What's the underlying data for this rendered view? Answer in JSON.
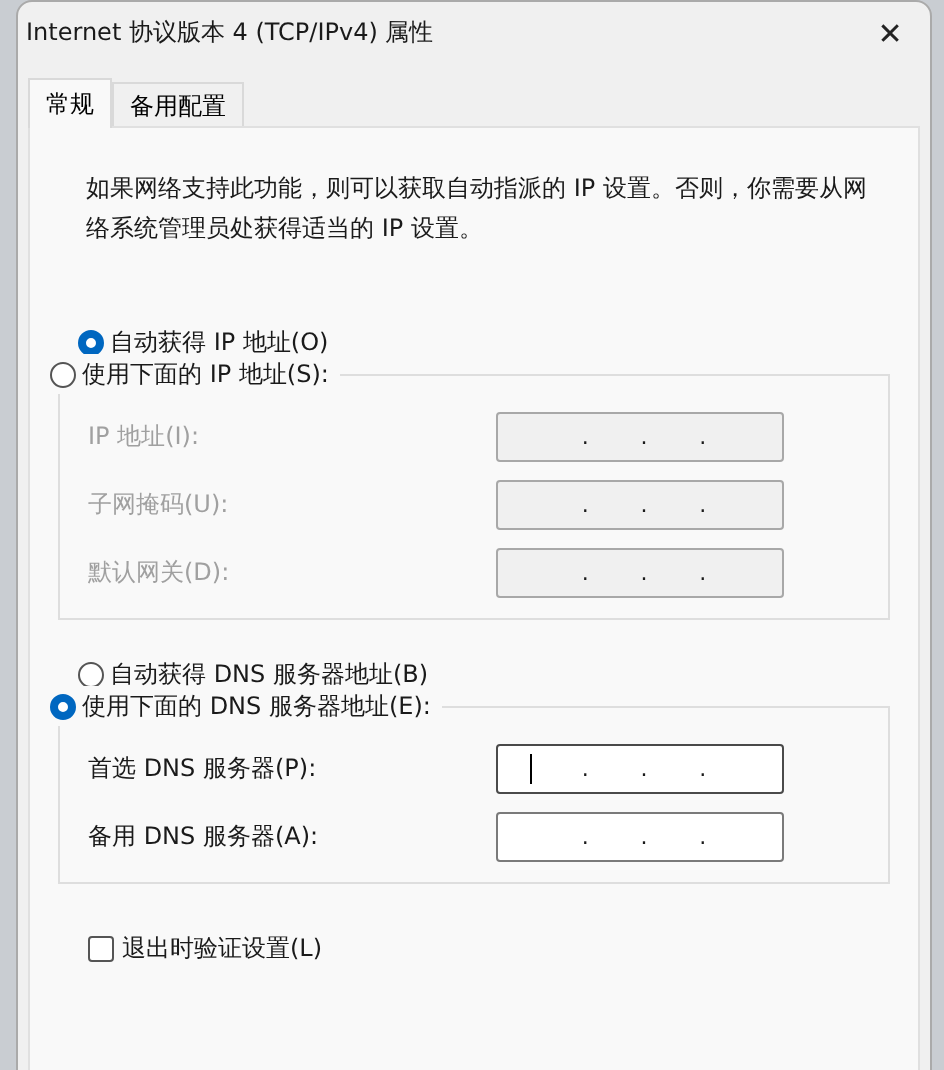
{
  "window": {
    "title": "Internet 协议版本 4 (TCP/IPv4) 属性",
    "close": "✕"
  },
  "tabs": [
    {
      "label": "常规",
      "selected": true
    },
    {
      "label": "备用配置",
      "selected": false
    }
  ],
  "description": "如果网络支持此功能，则可以获取自动指派的 IP 设置。否则，你需要从网络系统管理员处获得适当的 IP 设置。",
  "ip_mode": {
    "options": [
      {
        "label": "自动获得 IP 地址(O)",
        "selected": true
      },
      {
        "label": "使用下面的 IP 地址(S):",
        "selected": false
      }
    ],
    "fields": [
      {
        "label": "IP 地址(I):",
        "dots": [
          ".",
          ".",
          "."
        ],
        "disabled": true,
        "focused": false
      },
      {
        "label": "子网掩码(U):",
        "dots": [
          ".",
          ".",
          "."
        ],
        "disabled": true,
        "focused": false
      },
      {
        "label": "默认网关(D):",
        "dots": [
          ".",
          ".",
          "."
        ],
        "disabled": true,
        "focused": false
      }
    ]
  },
  "dns_mode": {
    "options": [
      {
        "label": "自动获得 DNS 服务器地址(B)",
        "selected": false
      },
      {
        "label": "使用下面的 DNS 服务器地址(E):",
        "selected": true
      }
    ],
    "fields": [
      {
        "label": "首选 DNS 服务器(P):",
        "dots": [
          ".",
          ".",
          "."
        ],
        "disabled": false,
        "focused": true
      },
      {
        "label": "备用 DNS 服务器(A):",
        "dots": [
          ".",
          ".",
          "."
        ],
        "disabled": false,
        "focused": false
      }
    ]
  },
  "validate": {
    "label": "退出时验证设置(L)",
    "checked": false
  }
}
